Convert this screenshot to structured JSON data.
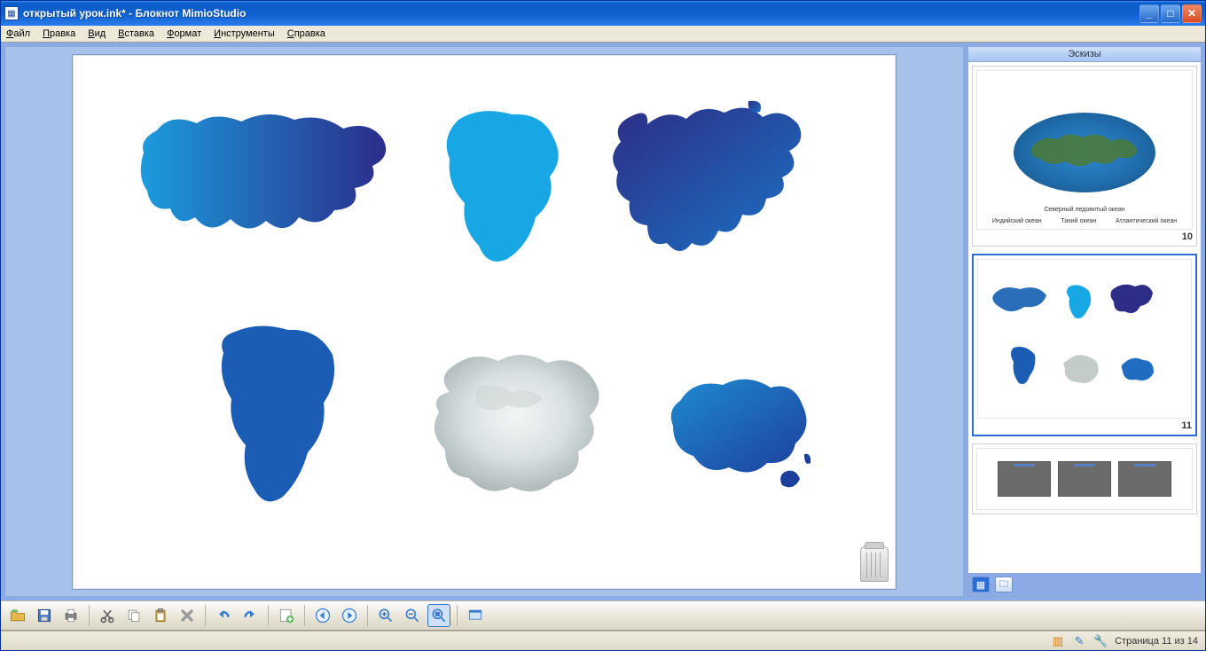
{
  "window": {
    "title": "открытый урок.ink* - Блокнот MimioStudio"
  },
  "menu": {
    "items": [
      {
        "accel": "Ф",
        "rest": "айл"
      },
      {
        "accel": "П",
        "rest": "равка"
      },
      {
        "accel": "В",
        "rest": "ид"
      },
      {
        "accel": "В",
        "rest": "ставка"
      },
      {
        "accel": "Ф",
        "rest": "ормат"
      },
      {
        "accel": "И",
        "rest": "нструменты"
      },
      {
        "accel": "С",
        "rest": "правка"
      }
    ]
  },
  "sidepanel": {
    "title": "Эскизы",
    "thumbs": [
      {
        "page": "10",
        "selected": false,
        "kind": "globe"
      },
      {
        "page": "11",
        "selected": true,
        "kind": "continents"
      },
      {
        "page": "",
        "selected": false,
        "kind": "strip"
      }
    ],
    "thumb10_labels": {
      "top": "Северный ледовитый океан",
      "bottom": [
        "Индийский океан",
        "Тихий океан",
        "Атлантический океан"
      ]
    }
  },
  "toolbar": {
    "tools": [
      {
        "name": "open-button",
        "icon": "open",
        "group": 0
      },
      {
        "name": "save-button",
        "icon": "save",
        "group": 0
      },
      {
        "name": "print-button",
        "icon": "print",
        "group": 0
      },
      {
        "name": "cut-button",
        "icon": "cut",
        "group": 1
      },
      {
        "name": "copy-button",
        "icon": "copy",
        "group": 1
      },
      {
        "name": "paste-button",
        "icon": "paste",
        "group": 1
      },
      {
        "name": "delete-button",
        "icon": "delete",
        "group": 1
      },
      {
        "name": "undo-button",
        "icon": "undo",
        "group": 2
      },
      {
        "name": "redo-button",
        "icon": "redo",
        "group": 2
      },
      {
        "name": "new-slide-button",
        "icon": "newslide",
        "group": 3
      },
      {
        "name": "prev-page-button",
        "icon": "prev",
        "group": 4
      },
      {
        "name": "next-page-button",
        "icon": "next",
        "group": 4
      },
      {
        "name": "zoom-in-button",
        "icon": "zoomin",
        "group": 5
      },
      {
        "name": "zoom-out-button",
        "icon": "zoomout",
        "group": 5
      },
      {
        "name": "zoom-fit-button",
        "icon": "zoomfit",
        "group": 5,
        "active": true
      },
      {
        "name": "fullscreen-button",
        "icon": "fullscreen",
        "group": 6
      }
    ]
  },
  "status": {
    "page_text": "Страница 11 из 14"
  },
  "continents": [
    "Eurasia",
    "Africa",
    "North America",
    "South America",
    "Antarctica",
    "Australia"
  ]
}
